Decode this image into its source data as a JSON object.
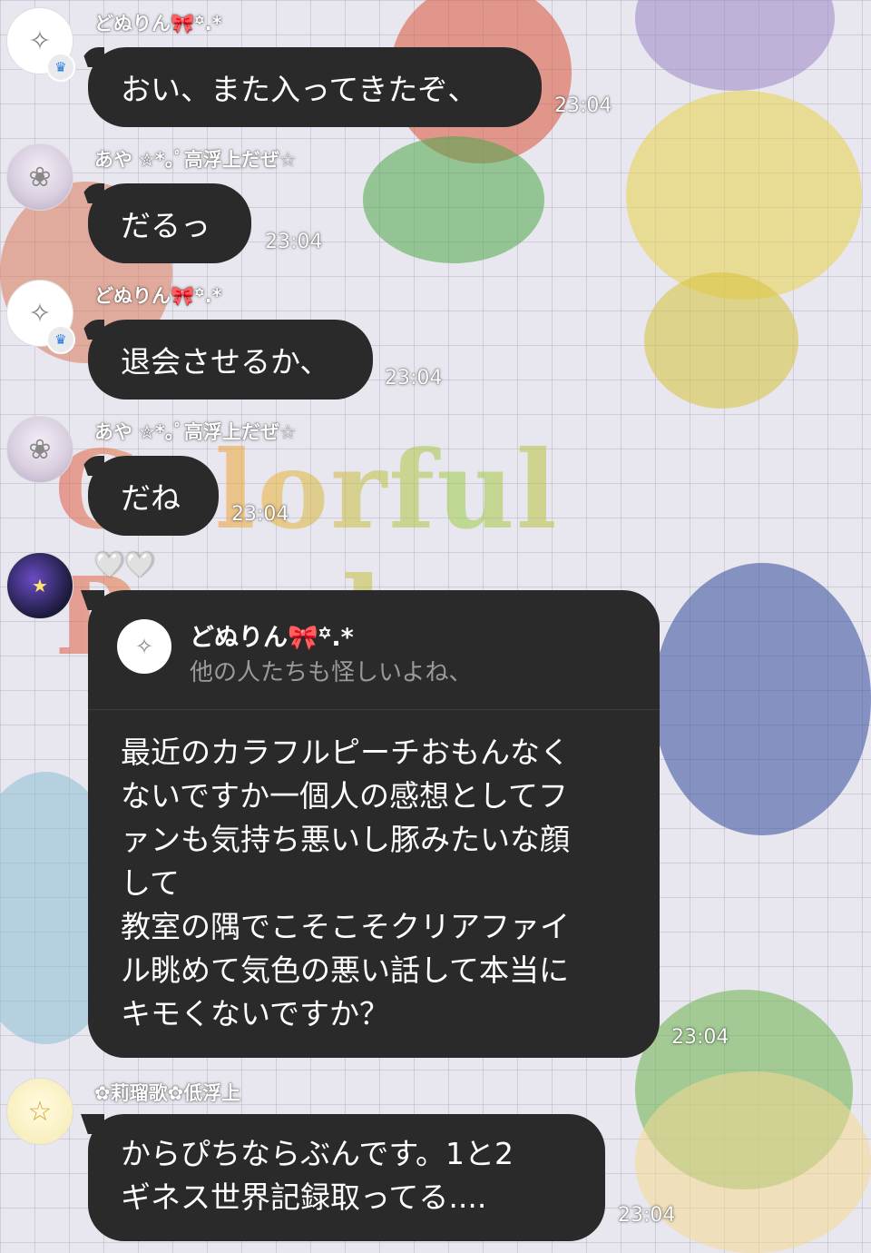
{
  "background_text": "Colorful Peach",
  "messages": [
    {
      "sender": "どぬりん🎀꙳.*",
      "text": "おい、また入ってきたぞ、",
      "time": "23:04",
      "avatar_icon": "character-avatar",
      "badge_icon": "crown-icon"
    },
    {
      "sender": "あや ✮*｡ﾟ高浮上だぜ☆",
      "text": "だるっ",
      "time": "23:04",
      "avatar_icon": "character-avatar"
    },
    {
      "sender": "どぬりん🎀꙳.*",
      "text": "退会させるか、",
      "time": "23:04",
      "avatar_icon": "character-avatar",
      "badge_icon": "crown-icon"
    },
    {
      "sender": "あや ✮*｡ﾟ高浮上だぜ☆",
      "text": "だね",
      "time": "23:04",
      "avatar_icon": "character-avatar"
    }
  ],
  "reply_message": {
    "sender_hearts": "🤍🤍",
    "quoted_sender": "どぬりん🎀꙳.*",
    "quoted_text": "他の人たちも怪しいよね、",
    "text": "最近のカラフルピーチおもんなく\nないですか一個人の感想としてフ\nァンも気持ち悪いし豚みたいな顔\nして\n教室の隅でこそこそクリアファイ\nル眺めて気色の悪い話して本当に\nキモくないですか？",
    "time": "23:04"
  },
  "last_message": {
    "sender": "✿莉瑠歌✿低浮上",
    "text": "からぴちならぶんです。1と2\nギネス世界記録取ってる....",
    "time": "23:04"
  },
  "colors": {
    "bubble": "#2a2a2a",
    "accent_crown": "#2a7be0"
  }
}
